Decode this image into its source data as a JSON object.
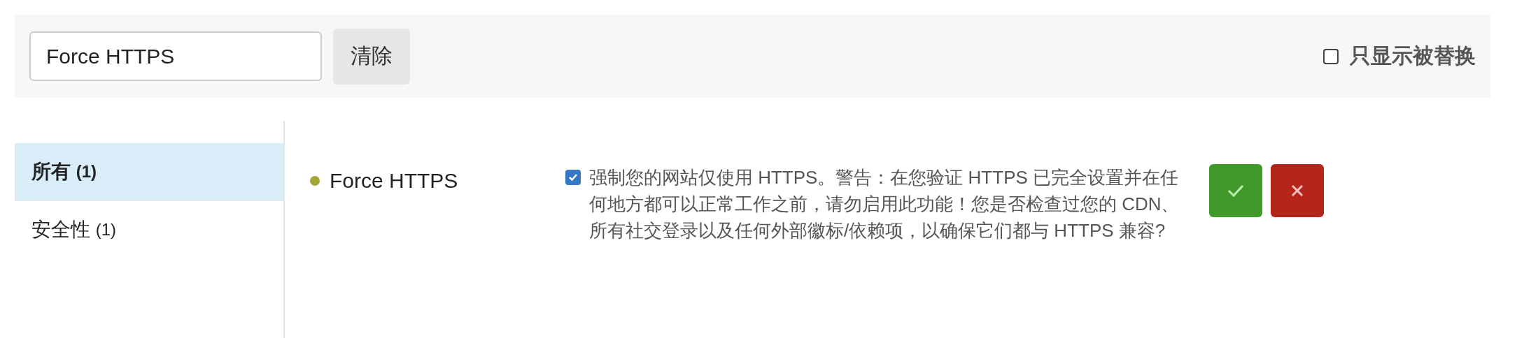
{
  "toolbar": {
    "search": {
      "value": "Force HTTPS"
    },
    "clear_button": "清除",
    "only_replaced": {
      "label": "只显示被替换",
      "checked": false
    }
  },
  "sidebar": {
    "items": [
      {
        "label": "所有",
        "count": "(1)",
        "selected": true
      },
      {
        "label": "安全性",
        "count": "(1)",
        "selected": false
      }
    ]
  },
  "rules": [
    {
      "title": "Force HTTPS",
      "color": "#a3a635",
      "checked": true,
      "description": "强制您的网站仅使用 HTTPS。警告：在您验证 HTTPS 已完全设置并在任何地方都可以正常工作之前，请勿启用此功能！您是否检查过您的 CDN、所有社交登录以及任何外部徽标/依赖项，以确保它们都与 HTTPS 兼容?"
    }
  ]
}
